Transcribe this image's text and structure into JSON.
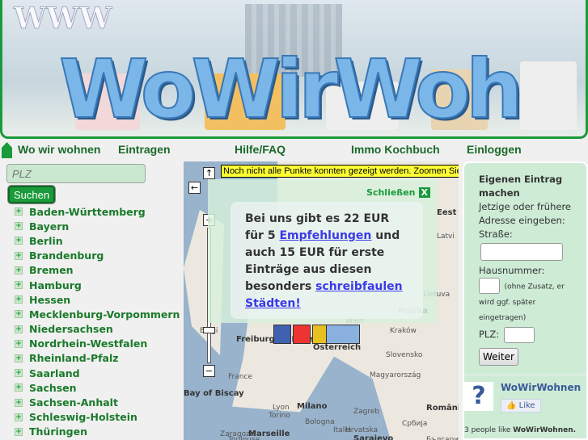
{
  "banner": {
    "logo_text": "WoWirWohnen",
    "www": "WWW"
  },
  "nav": {
    "items": [
      "Wo wir wohnen",
      "Eintragen",
      "Hilfe/FAQ",
      "Immo Kochbuch",
      "Einloggen"
    ]
  },
  "search": {
    "placeholder": "PLZ",
    "button": "Suchen"
  },
  "states": [
    "Baden-Württemberg",
    "Bayern",
    "Berlin",
    "Brandenburg",
    "Bremen",
    "Hamburg",
    "Hessen",
    "Mecklenburg-Vorpommern",
    "Niedersachsen",
    "Nordrhein-Westfalen",
    "Rheinland-Pfalz",
    "Saarland",
    "Sachsen",
    "Sachsen-Anhalt",
    "Schleswig-Holstein",
    "Thüringen"
  ],
  "map": {
    "notice": "Noch nicht alle Punkte konnten gezeigt werden. Zoomen Sie",
    "close": "Schließen",
    "close_x": "X",
    "promo": {
      "t1": "Bei uns gibt es 22 EUR für 5 ",
      "link1": "Empfehlungen",
      "t2": " und auch 15 EUR für erste Einträge aus diesen besonders ",
      "link2": "schreibfaulen Städten!"
    },
    "labels": [
      "Eest",
      "Latvi",
      "Lietuva",
      "Polska",
      "Kraków",
      "Slovensko",
      "Österreich",
      "Magyarország",
      "France",
      "Bay of Biscay",
      "Lyon",
      "Torino",
      "Milano",
      "Bologna",
      "Hrvatska",
      "România",
      "Italia",
      "Zaragoza",
      "Marseille",
      "Toulouse",
      "Србија",
      "Sarajevo",
      "България",
      "Belgi",
      "Freiburg im Breisgau",
      "Wien",
      "Zagreb"
    ]
  },
  "entry": {
    "title": "Eigenen Eintrag machen",
    "intro": "Jetzige oder frühere Adresse eingeben:",
    "street": "Straße:",
    "house": "Hausnummer:",
    "house_note": "(ohne Zusatz, er wird ggf. später eingetragen)",
    "plz": "PLZ:",
    "button": "Weiter"
  },
  "facebook": {
    "name": "WoWirWohnen",
    "like": "Like",
    "count_text": "3 people like",
    "count_name": "WoWirWohnen."
  }
}
